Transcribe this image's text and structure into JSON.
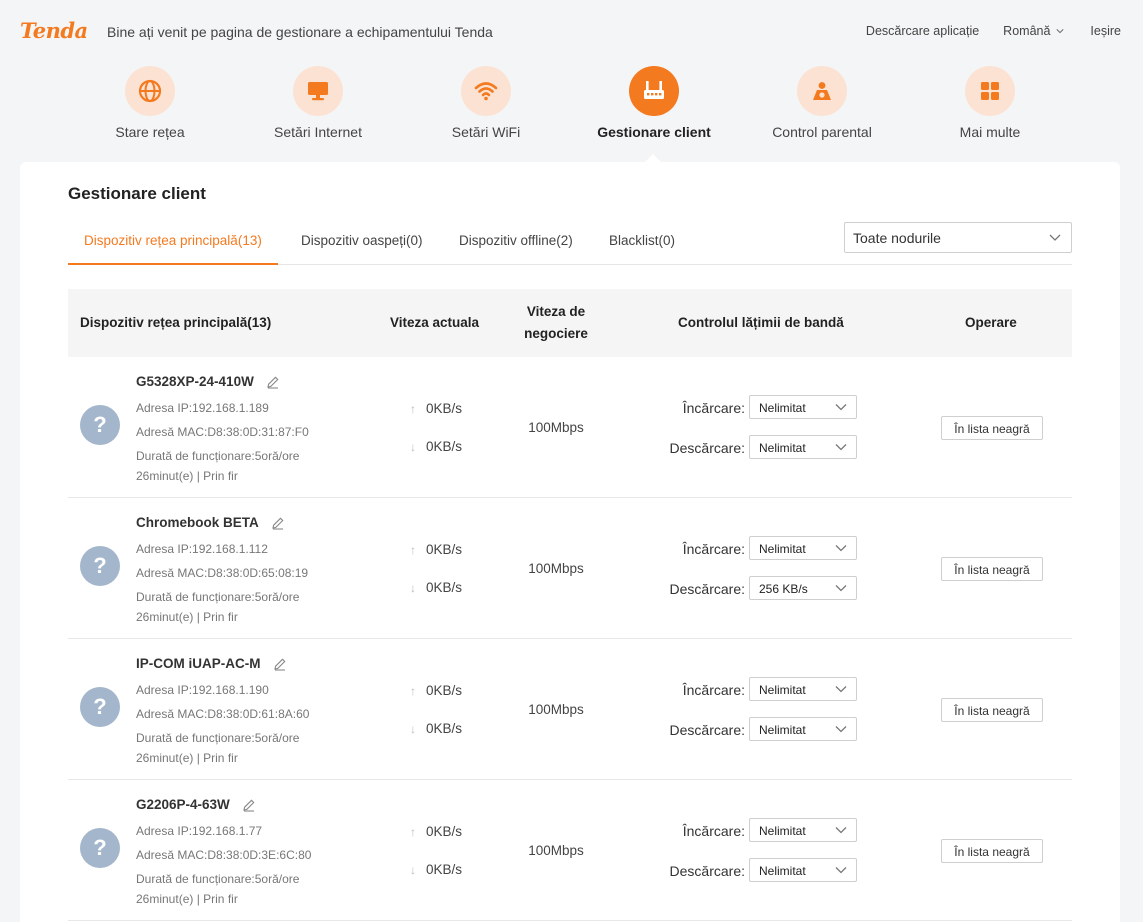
{
  "header": {
    "logo": "Tenda",
    "welcome": "Bine ați venit pe pagina de gestionare a echipamentului Tenda",
    "download_app": "Descărcare aplicație",
    "language": "Română",
    "exit": "Ieșire"
  },
  "nav": {
    "items": [
      {
        "label": "Stare rețea",
        "icon": "globe-icon"
      },
      {
        "label": "Setări Internet",
        "icon": "monitor-icon"
      },
      {
        "label": "Setări WiFi",
        "icon": "wifi-icon"
      },
      {
        "label": "Gestionare client",
        "icon": "router-icon",
        "active": true
      },
      {
        "label": "Control parental",
        "icon": "parental-icon"
      },
      {
        "label": "Mai multe",
        "icon": "grid-icon"
      }
    ]
  },
  "page": {
    "title": "Gestionare client",
    "tabs": [
      {
        "label": "Dispozitiv rețea principală(13)",
        "active": true
      },
      {
        "label": "Dispozitiv oaspeți(0)"
      },
      {
        "label": "Dispozitiv offline(2)"
      },
      {
        "label": "Blacklist(0)"
      }
    ],
    "node_filter": "Toate nodurile"
  },
  "table": {
    "headers": {
      "device": "Dispozitiv rețea principală(13)",
      "current_speed": "Viteza actuala",
      "nego_line1": "Viteza de",
      "nego_line2": "negociere",
      "bandwidth": "Controlul lățimii de bandă",
      "operation": "Operare"
    },
    "upload_label": "Încărcare:",
    "download_label": "Descărcare:",
    "blacklist_button": "În lista neagră",
    "rows": [
      {
        "name": "G5328XP-24-410W",
        "ip": "Adresa IP:192.168.1.189",
        "mac": "Adresă MAC:D8:38:0D:31:87:F0",
        "uptime1": "Durată de funcționare:5oră/ore",
        "uptime2": "26minut(e) | Prin fir",
        "up_speed": "0KB/s",
        "down_speed": "0KB/s",
        "nego": "100Mbps",
        "upload_limit": "Nelimitat",
        "download_limit": "Nelimitat"
      },
      {
        "name": "Chromebook BETA",
        "ip": "Adresa IP:192.168.1.112",
        "mac": "Adresă MAC:D8:38:0D:65:08:19",
        "uptime1": "Durată de funcționare:5oră/ore",
        "uptime2": "26minut(e) | Prin fir",
        "up_speed": "0KB/s",
        "down_speed": "0KB/s",
        "nego": "100Mbps",
        "upload_limit": "Nelimitat",
        "download_limit": "256 KB/s"
      },
      {
        "name": "IP-COM iUAP-AC-M",
        "ip": "Adresa IP:192.168.1.190",
        "mac": "Adresă MAC:D8:38:0D:61:8A:60",
        "uptime1": "Durată de funcționare:5oră/ore",
        "uptime2": "26minut(e) | Prin fir",
        "up_speed": "0KB/s",
        "down_speed": "0KB/s",
        "nego": "100Mbps",
        "upload_limit": "Nelimitat",
        "download_limit": "Nelimitat"
      },
      {
        "name": "G2206P-4-63W",
        "ip": "Adresa IP:192.168.1.77",
        "mac": "Adresă MAC:D8:38:0D:3E:6C:80",
        "uptime1": "Durată de funcționare:5oră/ore",
        "uptime2": "26minut(e) | Prin fir",
        "up_speed": "0KB/s",
        "down_speed": "0KB/s",
        "nego": "100Mbps",
        "upload_limit": "Nelimitat",
        "download_limit": "Nelimitat"
      }
    ]
  },
  "colors": {
    "accent": "#f47a20",
    "nav_icon_bg": "#fbe2d2",
    "avatar": "#a3b6cc"
  }
}
